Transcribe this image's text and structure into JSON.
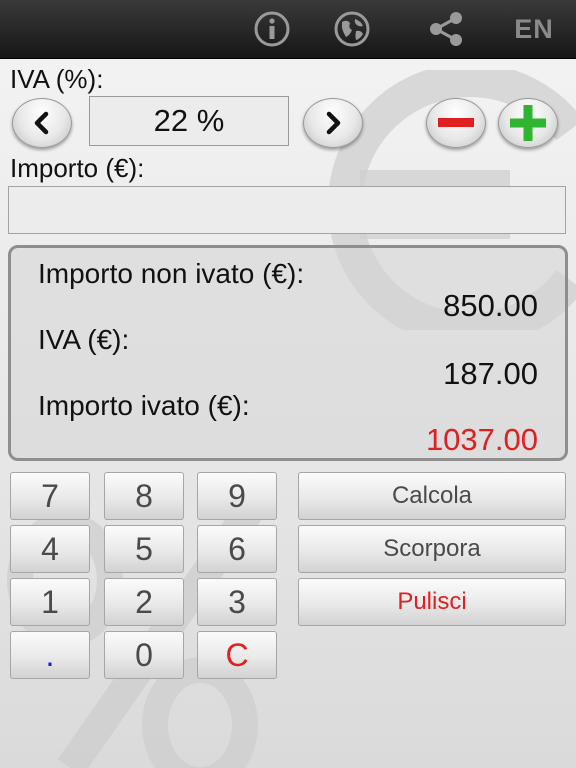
{
  "colors": {
    "accent_red": "#e02020",
    "plus_green": "#2fb52f",
    "dot_blue": "#1d1dcc"
  },
  "toolbar": {
    "icons": [
      "info-icon",
      "globe-icon",
      "share-icon"
    ],
    "language": "EN"
  },
  "vat": {
    "label": "IVA (%):",
    "rate": "22 %"
  },
  "amount": {
    "label": "Importo (€):",
    "value": ""
  },
  "results": {
    "net_label": "Importo non ivato (€):",
    "net_value": "850.00",
    "vat_label": "IVA (€):",
    "vat_value": "187.00",
    "gross_label": "Importo ivato (€):",
    "gross_value": "1037.00"
  },
  "keypad": {
    "k7": "7",
    "k8": "8",
    "k9": "9",
    "k4": "4",
    "k5": "5",
    "k6": "6",
    "k1": "1",
    "k2": "2",
    "k3": "3",
    "kdot": ".",
    "k0": "0",
    "kc": "C"
  },
  "actions": {
    "calculate": "Calcola",
    "extract": "Scorpora",
    "clear": "Pulisci"
  }
}
